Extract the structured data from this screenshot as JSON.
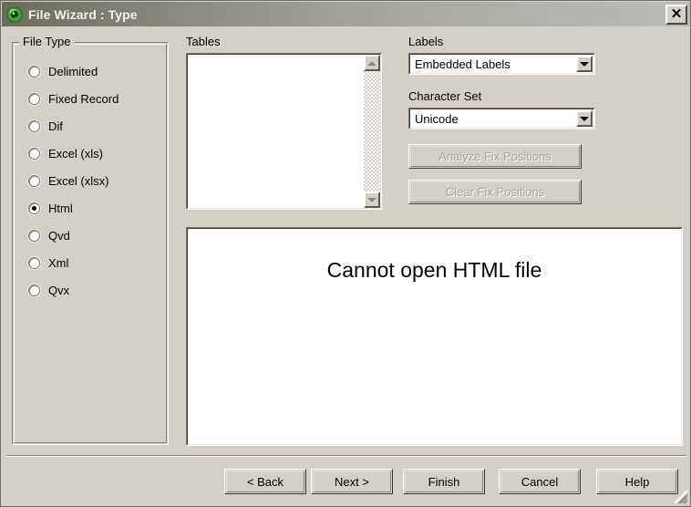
{
  "window": {
    "title": "File Wizard : Type",
    "icon": "qlikview-logo-icon",
    "close_label": "✕"
  },
  "file_type_group": {
    "title": "File Type",
    "selected": "Html",
    "options": [
      {
        "label": "Delimited",
        "checked": false
      },
      {
        "label": "Fixed Record",
        "checked": false
      },
      {
        "label": "Dif",
        "checked": false
      },
      {
        "label": "Excel (xls)",
        "checked": false
      },
      {
        "label": "Excel (xlsx)",
        "checked": false
      },
      {
        "label": "Html",
        "checked": true
      },
      {
        "label": "Qvd",
        "checked": false
      },
      {
        "label": "Xml",
        "checked": false
      },
      {
        "label": "Qvx",
        "checked": false
      }
    ]
  },
  "tables": {
    "label": "Tables",
    "items": []
  },
  "labels_field": {
    "label": "Labels",
    "value": "Embedded Labels"
  },
  "charset_field": {
    "label": "Character Set",
    "value": "Unicode"
  },
  "fix_position_buttons": {
    "analyze": "Analyze Fix Positions",
    "clear": "Clear Fix Positions"
  },
  "preview": {
    "message": "Cannot open HTML file"
  },
  "footer": {
    "back": "< Back",
    "next": "Next >",
    "finish": "Finish",
    "cancel": "Cancel",
    "help": "Help"
  },
  "colors": {
    "dialog_face": "#d4d0c8",
    "titlebar_start": "#6b6b5d",
    "titlebar_end": "#bcbcb7",
    "title_text": "#f2f2ee",
    "logo_green": "#2aa02a",
    "disabled_text": "#a6a49c"
  }
}
